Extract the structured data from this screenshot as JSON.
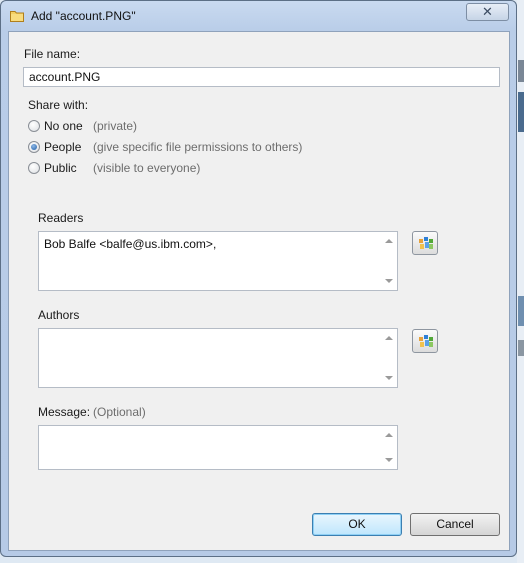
{
  "dialog": {
    "title": "Add \"account.PNG\"",
    "close_glyph": "✕"
  },
  "file_name": {
    "label": "File name:",
    "value": "account.PNG"
  },
  "share_with": {
    "label": "Share with:",
    "options": [
      {
        "label": "No one",
        "hint": "(private)",
        "checked": false
      },
      {
        "label": "People",
        "hint": "(give specific file permissions to others)",
        "checked": true
      },
      {
        "label": "Public",
        "hint": "(visible to everyone)",
        "checked": false
      }
    ]
  },
  "readers": {
    "label": "Readers",
    "value": "Bob Balfe <balfe@us.ibm.com>,",
    "picker_icon": "people-picker-icon"
  },
  "authors": {
    "label": "Authors",
    "value": "",
    "picker_icon": "people-picker-icon"
  },
  "message": {
    "label": "Message:",
    "hint": "(Optional)",
    "value": ""
  },
  "buttons": {
    "ok": "OK",
    "cancel": "Cancel"
  },
  "colors": {
    "accent": "#3c7fb1",
    "window_frame": "#b9cde8",
    "client_bg": "#f0f0f0"
  }
}
